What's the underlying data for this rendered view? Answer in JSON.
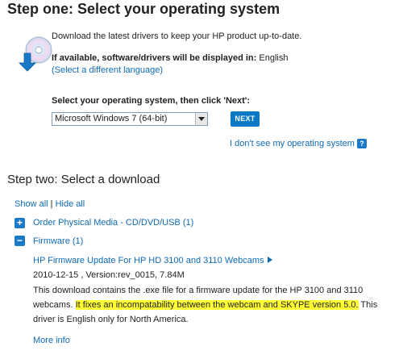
{
  "step_one": {
    "title": "Step one: Select your operating system",
    "intro": "Download the latest drivers to keep your HP product up-to-date.",
    "language_label": "If available, software/drivers will be displayed in:",
    "language_value": "English",
    "change_language_link": "(Select a different language)",
    "select_prompt": "Select your operating system, then click 'Next':",
    "os_select_value": "Microsoft Windows 7 (64-bit)",
    "next_button": "NEXT",
    "os_missing_link": "I don't see my operating system",
    "help_icon_glyph": "?"
  },
  "step_two": {
    "title": "Step two: Select a download",
    "show_all": "Show all",
    "separator": "|",
    "hide_all": "Hide all",
    "categories": [
      {
        "label": "Order Physical Media - CD/DVD/USB (1)",
        "toggle": "+"
      },
      {
        "label": "Firmware (1)",
        "toggle": "−"
      }
    ],
    "download": {
      "title": "HP Firmware Update For HP HD 3100 and 3110 Webcams",
      "meta": "2010-12-15 , Version:rev_0015, 7.84M",
      "desc_part1": "This download contains the .exe file for a firmware update for the HP 3100 and 3110 webcams.",
      "desc_highlight": "It fixes an incompatability between the webcam and SKYPE version 5.0.",
      "desc_part2": "This driver is English only for North America.",
      "more_info": "More info"
    }
  },
  "colors": {
    "link": "#0f6bb6",
    "accent": "#1a79c8",
    "button": "#0a79c4",
    "highlight": "#ffff33"
  }
}
